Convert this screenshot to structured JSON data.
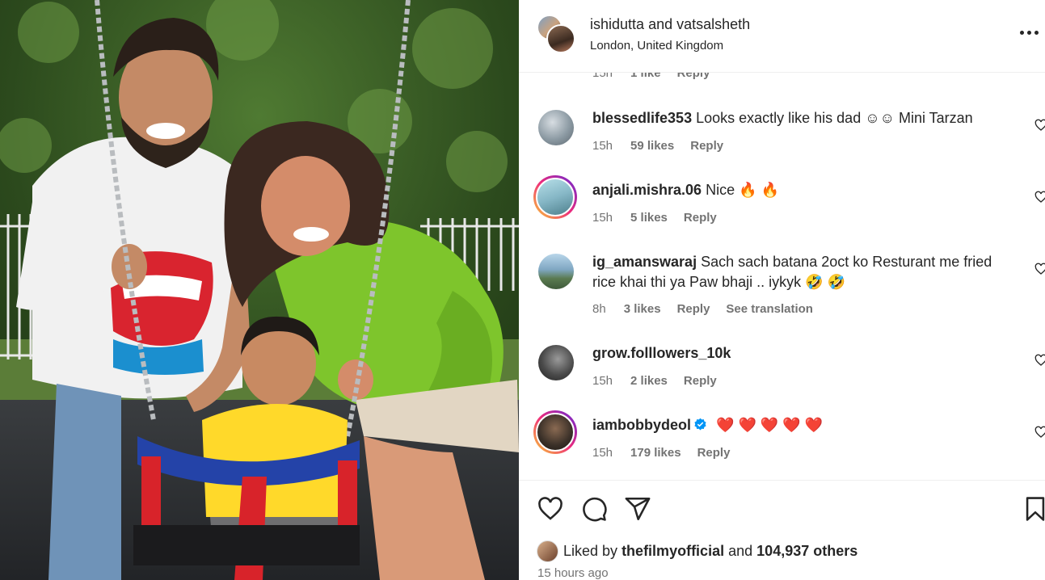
{
  "header": {
    "user1": "ishidutta",
    "joiner": "and",
    "user2": "vatsalsheth",
    "location": "London, United Kingdom",
    "more_icon": "more-horizontal-icon"
  },
  "partial_comment": {
    "time": "15h",
    "likes": "1 like",
    "reply": "Reply"
  },
  "comments": [
    {
      "username": "blessedlife353",
      "text": "Looks exactly like his dad ☺☺ Mini Tarzan",
      "time": "15h",
      "likes": "59 likes",
      "reply": "Reply",
      "avatar_color": "#8c9aa3"
    },
    {
      "username": "anjali.mishra.06",
      "text": "Nice 🔥 🔥",
      "time": "15h",
      "likes": "5 likes",
      "reply": "Reply",
      "avatar_color": "#86b7c6"
    },
    {
      "username": "ig_amanswaraj",
      "text": "Sach sach batana 2oct ko Resturant me fried rice khai thi ya Paw bhaji .. iykyk 🤣 🤣",
      "time": "8h",
      "likes": "3 likes",
      "reply": "Reply",
      "translation": "See translation",
      "avatar_color": "#7fa7c2"
    },
    {
      "username": "grow.folllowers_10k",
      "text": "",
      "time": "15h",
      "likes": "2 likes",
      "reply": "Reply",
      "avatar_color": "#4a4a4a"
    },
    {
      "username": "iambobbydeol",
      "text": "❤️ ❤️ ❤️ ❤️ ❤️",
      "time": "15h",
      "likes": "179 likes",
      "reply": "Reply",
      "avatar_color": "#3a3028",
      "verified": true
    }
  ],
  "actions": {
    "like_icon": "heart-icon",
    "comment_icon": "comment-icon",
    "share_icon": "share-icon",
    "save_icon": "bookmark-icon"
  },
  "liked_by": {
    "prefix": "Liked by",
    "user": "thefilmyofficial",
    "and": "and",
    "count": "104,937 others"
  },
  "time_ago": "15 hours ago",
  "colors": {
    "verified_blue": "#0095f6",
    "story_ring_start": "#f9ce34",
    "story_ring_mid": "#ee2a7b",
    "story_ring_end": "#6228d7"
  }
}
